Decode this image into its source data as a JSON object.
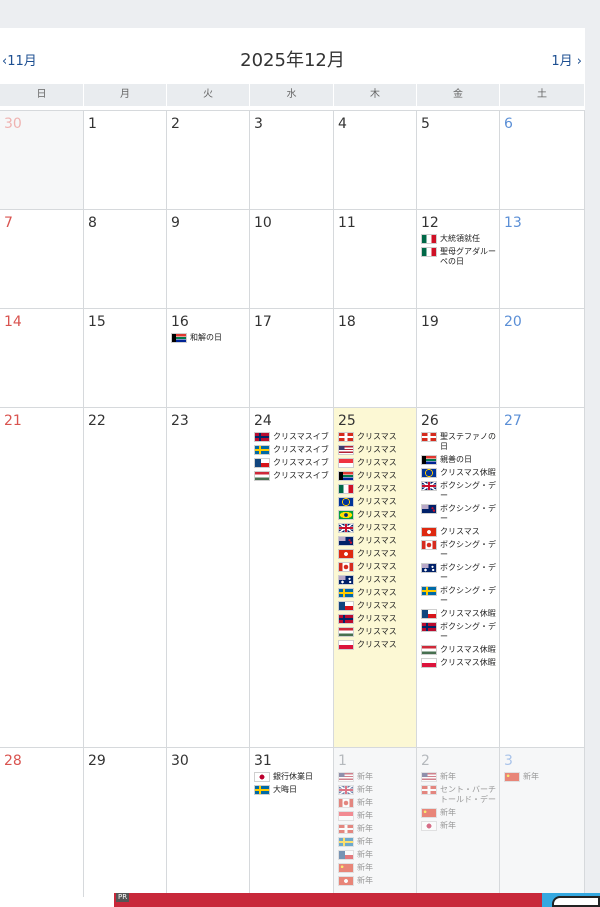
{
  "header": {
    "prev": "‹11月",
    "next": "1月 ›",
    "title": "2025年12月"
  },
  "weekdays": [
    "日",
    "月",
    "火",
    "水",
    "木",
    "金",
    "土"
  ],
  "colors": {
    "today_bg": "#fcf8d4",
    "link": "#1d4f91",
    "sunday": "#d9534f",
    "saturday": "#5b8fd6"
  },
  "weeks": [
    [
      {
        "day": "30",
        "other": true,
        "events": []
      },
      {
        "day": "1",
        "events": []
      },
      {
        "day": "2",
        "events": []
      },
      {
        "day": "3",
        "events": []
      },
      {
        "day": "4",
        "events": []
      },
      {
        "day": "5",
        "events": []
      },
      {
        "day": "6",
        "events": []
      }
    ],
    [
      {
        "day": "7",
        "events": []
      },
      {
        "day": "8",
        "events": []
      },
      {
        "day": "9",
        "events": []
      },
      {
        "day": "10",
        "events": []
      },
      {
        "day": "11",
        "events": []
      },
      {
        "day": "12",
        "events": [
          {
            "flag": "mexico-flag",
            "text": "大統領就任"
          },
          {
            "flag": "mexico-flag",
            "text": "聖母グアダルーペの日"
          }
        ]
      },
      {
        "day": "13",
        "events": []
      }
    ],
    [
      {
        "day": "14",
        "events": []
      },
      {
        "day": "15",
        "events": []
      },
      {
        "day": "16",
        "events": [
          {
            "flag": "south-africa-flag",
            "text": "和解の日"
          }
        ]
      },
      {
        "day": "17",
        "events": []
      },
      {
        "day": "18",
        "events": []
      },
      {
        "day": "19",
        "events": []
      },
      {
        "day": "20",
        "events": []
      }
    ],
    [
      {
        "day": "21",
        "events": []
      },
      {
        "day": "22",
        "events": []
      },
      {
        "day": "23",
        "events": []
      },
      {
        "day": "24",
        "events": [
          {
            "flag": "norway-flag",
            "text": "クリスマスイブ"
          },
          {
            "flag": "sweden-flag",
            "text": "クリスマスイブ"
          },
          {
            "flag": "czech-flag",
            "text": "クリスマスイブ"
          },
          {
            "flag": "hungary-flag",
            "text": "クリスマスイブ"
          }
        ]
      },
      {
        "day": "25",
        "today": true,
        "events": [
          {
            "flag": "switzerland-flag",
            "text": "クリスマス"
          },
          {
            "flag": "usa-flag",
            "text": "クリスマス"
          },
          {
            "flag": "singapore-flag",
            "text": "クリスマス"
          },
          {
            "flag": "south-africa-flag",
            "text": "クリスマス"
          },
          {
            "flag": "mexico-flag",
            "text": "クリスマス"
          },
          {
            "flag": "eu-flag",
            "text": "クリスマス"
          },
          {
            "flag": "brazil-flag",
            "text": "クリスマス"
          },
          {
            "flag": "uk-flag",
            "text": "クリスマス"
          },
          {
            "flag": "new-zealand-flag",
            "text": "クリスマス"
          },
          {
            "flag": "hong-kong-flag",
            "text": "クリスマス"
          },
          {
            "flag": "canada-flag",
            "text": "クリスマス"
          },
          {
            "flag": "australia-flag",
            "text": "クリスマス"
          },
          {
            "flag": "sweden-flag",
            "text": "クリスマス"
          },
          {
            "flag": "czech-flag",
            "text": "クリスマス"
          },
          {
            "flag": "norway-flag",
            "text": "クリスマス"
          },
          {
            "flag": "hungary-flag",
            "text": "クリスマス"
          },
          {
            "flag": "poland-flag",
            "text": "クリスマス"
          }
        ]
      },
      {
        "day": "26",
        "events": [
          {
            "flag": "switzerland-flag",
            "text": "聖ステファノの日"
          },
          {
            "flag": "south-africa-flag",
            "text": "親善の日"
          },
          {
            "flag": "eu-flag",
            "text": "クリスマス休暇"
          },
          {
            "flag": "uk-flag",
            "text": "ボクシング・デー"
          },
          {
            "flag": "new-zealand-flag",
            "text": "ボクシング・デー"
          },
          {
            "flag": "hong-kong-flag",
            "text": "クリスマス"
          },
          {
            "flag": "canada-flag",
            "text": "ボクシング・デー"
          },
          {
            "flag": "australia-flag",
            "text": "ボクシング・デー"
          },
          {
            "flag": "sweden-flag",
            "text": "ボクシング・デー"
          },
          {
            "flag": "czech-flag",
            "text": "クリスマス休暇"
          },
          {
            "flag": "norway-flag",
            "text": "ボクシング・デー"
          },
          {
            "flag": "hungary-flag",
            "text": "クリスマス休暇"
          },
          {
            "flag": "poland-flag",
            "text": "クリスマス休暇"
          }
        ]
      },
      {
        "day": "27",
        "events": []
      }
    ],
    [
      {
        "day": "28",
        "events": []
      },
      {
        "day": "29",
        "events": []
      },
      {
        "day": "30",
        "events": []
      },
      {
        "day": "31",
        "events": [
          {
            "flag": "japan-flag",
            "text": "銀行休業日"
          },
          {
            "flag": "sweden-flag",
            "text": "大晦日"
          }
        ]
      },
      {
        "day": "1",
        "other": true,
        "events": [
          {
            "flag": "usa-flag",
            "text": "新年"
          },
          {
            "flag": "uk-flag",
            "text": "新年"
          },
          {
            "flag": "canada-flag",
            "text": "新年"
          },
          {
            "flag": "singapore-flag",
            "text": "新年"
          },
          {
            "flag": "switzerland-flag",
            "text": "新年"
          },
          {
            "flag": "sweden-flag",
            "text": "新年"
          },
          {
            "flag": "czech-flag",
            "text": "新年"
          },
          {
            "flag": "china-flag",
            "text": "新年"
          },
          {
            "flag": "hong-kong-flag",
            "text": "新年"
          }
        ]
      },
      {
        "day": "2",
        "other": true,
        "events": [
          {
            "flag": "usa-flag",
            "text": "新年"
          },
          {
            "flag": "switzerland-flag",
            "text": "セント・バーチトールド・デー"
          },
          {
            "flag": "china-flag",
            "text": "新年"
          },
          {
            "flag": "japan-flag",
            "text": "新年"
          }
        ]
      },
      {
        "day": "3",
        "other": true,
        "events": [
          {
            "flag": "china-flag",
            "text": "新年"
          }
        ]
      }
    ]
  ],
  "ad": {
    "pr": "PR"
  }
}
